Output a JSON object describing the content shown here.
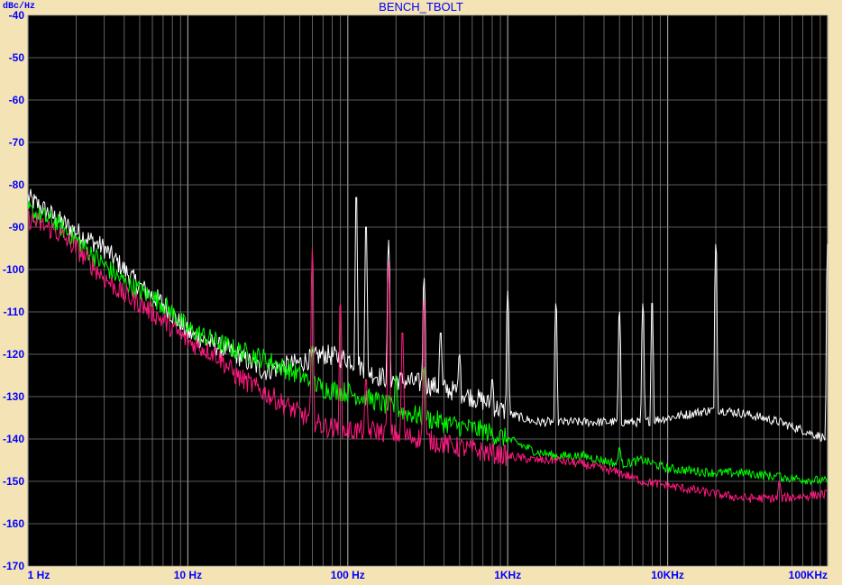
{
  "window": {
    "title": "BENCH_TBOLT",
    "y_unit": "dBc/Hz"
  },
  "colors": {
    "background": "#f3e3b5",
    "plot": "#000000",
    "grid": "#7a7a7a",
    "text": "#0000ff"
  },
  "chart_data": {
    "type": "line",
    "title": "BENCH_TBOLT",
    "ylabel": "dBc/Hz",
    "xlabel": "",
    "xscale": "log",
    "xlim": [
      1,
      100000
    ],
    "ylim": [
      -170,
      -40
    ],
    "grid": true,
    "yticks": [
      -40,
      -50,
      -60,
      -70,
      -80,
      -90,
      -100,
      -110,
      -120,
      -130,
      -140,
      -150,
      -160,
      -170
    ],
    "ytick_labels": [
      "-40",
      "-50",
      "-60",
      "-70",
      "-80",
      "-90",
      "-100",
      "-110",
      "-120",
      "-130",
      "-140",
      "-150",
      "-160",
      "-170"
    ],
    "xticks": [
      1,
      10,
      100,
      1000,
      10000,
      100000
    ],
    "xtick_labels": [
      "1 Hz",
      "10 Hz",
      "100 Hz",
      "1KHz",
      "10KHz",
      "100KHz"
    ],
    "series": [
      {
        "color": "#ffffff",
        "x": [
          1,
          1.5,
          2,
          3,
          4,
          5,
          7,
          10,
          15,
          20,
          30,
          50,
          70,
          100,
          150,
          200,
          300,
          500,
          700,
          1000,
          1500,
          2000,
          3000,
          5000,
          7000,
          10000,
          20000,
          30000,
          50000,
          100000
        ],
        "y": [
          -83,
          -88,
          -91,
          -95,
          -100,
          -104,
          -108,
          -115,
          -118,
          -120,
          -124,
          -122,
          -120,
          -121,
          -125,
          -126,
          -127,
          -129,
          -131,
          -134,
          -136,
          -136,
          -136,
          -136,
          -136,
          -135,
          -133,
          -134,
          -136,
          -140
        ],
        "spurs": [
          [
            113,
            -83
          ],
          [
            130,
            -90
          ],
          [
            180,
            -93
          ],
          [
            300,
            -102
          ],
          [
            380,
            -115
          ],
          [
            500,
            -120
          ],
          [
            800,
            -126
          ],
          [
            1000,
            -105
          ],
          [
            2000,
            -108
          ],
          [
            5000,
            -110
          ],
          [
            7000,
            -108
          ],
          [
            8000,
            -108
          ],
          [
            20000,
            -94
          ],
          [
            100000,
            -94
          ]
        ]
      },
      {
        "color": "#00ff00",
        "x": [
          1,
          1.5,
          2,
          3,
          4,
          5,
          7,
          10,
          15,
          20,
          30,
          50,
          70,
          100,
          150,
          200,
          300,
          500,
          700,
          1000,
          1500,
          2000,
          3000,
          5000,
          7000,
          10000,
          20000,
          30000,
          50000,
          100000
        ],
        "y": [
          -86,
          -89,
          -93,
          -99,
          -103,
          -105,
          -108,
          -114,
          -117,
          -119,
          -121,
          -125,
          -128,
          -129,
          -131,
          -133,
          -135,
          -137,
          -138,
          -140,
          -143,
          -144,
          -144,
          -146,
          -145,
          -147,
          -148,
          -148,
          -149,
          -150
        ],
        "spurs": [
          [
            60,
            -118
          ],
          [
            200,
            -125
          ],
          [
            300,
            -123
          ],
          [
            5000,
            -142
          ],
          [
            50000,
            -148
          ]
        ]
      },
      {
        "color": "#ff1a80",
        "x": [
          1,
          1.5,
          2,
          3,
          4,
          5,
          7,
          10,
          15,
          20,
          30,
          50,
          70,
          100,
          150,
          200,
          300,
          500,
          700,
          1000,
          1500,
          2000,
          3000,
          5000,
          7000,
          10000,
          20000,
          30000,
          50000,
          100000
        ],
        "y": [
          -88,
          -91,
          -95,
          -102,
          -106,
          -108,
          -112,
          -117,
          -120,
          -125,
          -129,
          -134,
          -137,
          -138,
          -138,
          -139,
          -140,
          -142,
          -143,
          -144,
          -145,
          -145,
          -146,
          -148,
          -150,
          -151,
          -153,
          -154,
          -154,
          -153
        ],
        "spurs": [
          [
            60,
            -95
          ],
          [
            90,
            -108
          ],
          [
            130,
            -126
          ],
          [
            180,
            -98
          ],
          [
            220,
            -115
          ],
          [
            300,
            -107
          ],
          [
            50000,
            -150
          ]
        ]
      }
    ]
  }
}
